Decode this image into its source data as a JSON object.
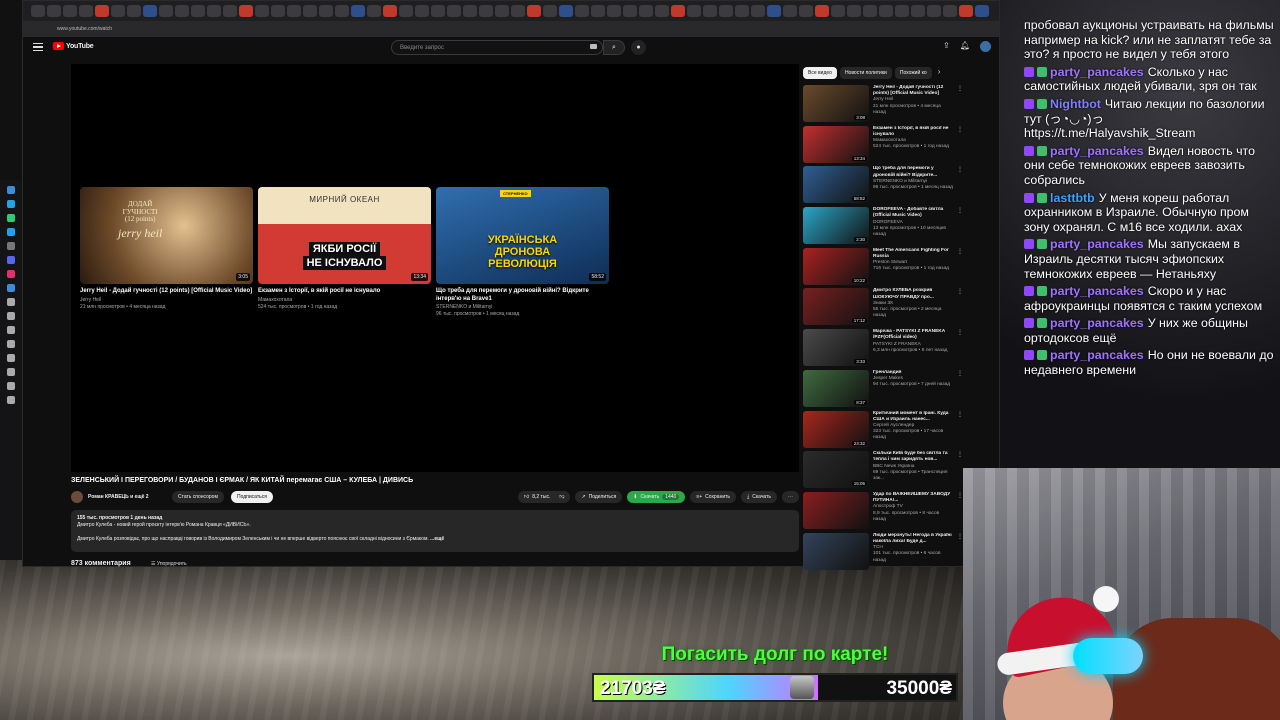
{
  "browser": {
    "url": "www.youtube.com/watch"
  },
  "youtube": {
    "search_placeholder": "Введите запрос",
    "video": {
      "title": "ЗЕЛЕНСЬКИЙ І ПЕРЕГОВОРИ / БУДАНОВ І ЄРМАК / ЯК КИТАЙ перемагає США – КУЛЕБА | ДИВИСЬ",
      "channel": "Роман КРАВЕЦЬ и ещё 2",
      "sponsor_label": "Стать спонсором",
      "subscribe_label": "Подписаться",
      "likes": "8,2 тыс.",
      "share_label": "Поделиться",
      "download_label": "Скачать",
      "quality_label": "1440",
      "save_label": "Сохранить",
      "download2_label": "Скачать",
      "stats": "155 тыс. просмотров  1 день назад",
      "desc_line1": "Дмитро Кулеба - новий герой проєкту інтерв'ю Романа Кравця «ДИВИСЬ».",
      "desc_line2": "Дмитро Кулеба розповідає, про що насправді говорив із Володимиром Зеленським і чи не вперше відверто пояснює свої складні відносини з Єрмаком.",
      "desc_more": "...ещё",
      "comments": "873 комментария",
      "sort_label": "Упорядочить"
    },
    "endcards": [
      {
        "title": "Jerry Heil - Додай гучності (12 points) [Official Music Video]",
        "channel": "Jerry Heil",
        "meta": "21 млн просмотров • 4 месяца назад",
        "duration": "3:05",
        "overlay_line1": "ДОДАЙ",
        "overlay_line2": "ГУЧНОСТІ",
        "overlay_line3": "(12 points)",
        "overlay_brand": "jerry heil"
      },
      {
        "title": "Екзамен з Історії, в якій росії не існувало",
        "channel": "Мамахохотала",
        "meta": "524 тыс. просмотров • 1 год назад",
        "duration": "13:34",
        "overlay_top": "МИРНИЙ ОКЕАН",
        "overlay_line1": "ЯКБИ РОСІЇ",
        "overlay_line2": "НЕ ІСНУВАЛО"
      },
      {
        "title": "Що треба для перемоги у дроновій війні? Відкрите інтерв'ю на Brave1",
        "channel": "STERNENKO и Militarnyi",
        "meta": "96 тыс. просмотров • 1 месяц назад",
        "duration": "58:52",
        "overlay_tag": "СТЕРНЕНКО",
        "overlay_line1": "УКРАЇНСЬКА",
        "overlay_line2": "ДРОНОВА",
        "overlay_line3": "РЕВОЛЮЦІЯ"
      }
    ],
    "chips": [
      "Все видео",
      "Новости политики",
      "Похожий ко"
    ],
    "recommendations": [
      {
        "title": "Jerry Heil - Додай гучності (12 points) [Official Music Video]",
        "channel": "Jerry Heil",
        "meta": "21 млн просмотров • 4 месяца назад",
        "duration": "3:08",
        "color": "#6b4a2c"
      },
      {
        "title": "Екзамен з Історії, в якій росії не існувало",
        "channel": "Мамахохотала",
        "meta": "524 тыс. просмотров • 1 год назад",
        "duration": "13:34",
        "color": "#c13030"
      },
      {
        "title": "Що треба для перемоги у дроновій війні? Відкрите...",
        "channel": "STERNENKO и Militarnyi",
        "meta": "96 тыс. просмотров • 1 месяц назад",
        "duration": "58:52",
        "color": "#2f5f93"
      },
      {
        "title": "DOROFEEVA - Добавте світла (Official Music Video)",
        "channel": "DOROFEEVA",
        "meta": "13 млн просмотров • 10 месяцев назад",
        "duration": "2:30",
        "color": "#2aa6c9"
      },
      {
        "title": "Meet The Americans Fighting For Russia",
        "channel": "Preston Stewart",
        "meta": "716 тыс. просмотров • 1 год назад",
        "duration": "10:22",
        "color": "#aa2222"
      },
      {
        "title": "Дмитро КУЛЕБА розкрив ШОКУЮЧУ ПРАВДУ про...",
        "channel": "Знаки ЗК",
        "meta": "55 тыс. просмотров • 2 месяца назад",
        "duration": "17:12",
        "color": "#7a2020"
      },
      {
        "title": "Марічка - PATSYKI Z FRANEKA /PZF(Official video)",
        "channel": "PATSYKI Z FRANEKA",
        "meta": "6,3 млн просмотров • 6 лет назад",
        "duration": "3:33",
        "color": "#4b4b4b"
      },
      {
        "title": "Гренландия",
        "channel": "Jesper Makes",
        "meta": "94 тыс. просмотров • 7 дней назад",
        "duration": "8:37",
        "color": "#3f6b3f"
      },
      {
        "title": "Критичний момент в Ірані. Куда США и Израиль нанес...",
        "channel": "Сергей Ауслендер",
        "meta": "323 тыс. просмотров • 17 часов назад",
        "duration": "23:32",
        "color": "#a8261d"
      },
      {
        "title": "Скільки Київ буде без світла та тепла і чим заридять нов...",
        "channel": "BBC News Україна",
        "meta": "69 тыс. просмотров • Трансляция зак...",
        "duration": "15:05",
        "color": "#2b2b2b"
      },
      {
        "title": "Удар по ВАЖНЕЙШЕМУ ЗАВОДУ ПУТИНА!...",
        "channel": "Апостроф TV",
        "meta": "8,9 тыс. просмотров • 8 часов назад",
        "duration": "",
        "color": "#8a1f1f"
      },
      {
        "title": "Люди мерзнуть! Негода в Україні накоїла лиха! Буде д...",
        "channel": "ТСН",
        "meta": "101 тыс. просмотров • 6 часов назад",
        "duration": "",
        "color": "#33445a"
      }
    ]
  },
  "chat": [
    {
      "user": "",
      "text": "пробовал аукционы устраивать на фильмы например на kick? или не заплатят тебе за это? я просто не видел у тебя этого"
    },
    {
      "user": "party_pancakes",
      "text": "Сколько у нас самостийных людей убивали, зря он так"
    },
    {
      "user": "Nightbot",
      "text": "Читаю лекции по базологии тут (っ◔◡◔)っ https://t.me/Halyavshik_Stream"
    },
    {
      "user": "party_pancakes",
      "text": "Видел новость что они себе темнокожих евреев завозить собрались"
    },
    {
      "user": "lasttbtb",
      "text": "У меня кореш работал охранником в Израиле. Обычную пром зону охранял. С м16 все ходили. ахах"
    },
    {
      "user": "party_pancakes",
      "text": "Мы запускаем в Израиль десятки тысяч эфиопских темнокожих евреев — Нетаньяху"
    },
    {
      "user": "party_pancakes",
      "text": "Скоро и у нас афроукраинцы появятся с таким успехом"
    },
    {
      "user": "party_pancakes",
      "text": "У них же общины ортодоксов ещё"
    },
    {
      "user": "party_pancakes",
      "text": "Но они не воевали до недавнего времени"
    }
  ],
  "donation": {
    "title": "Погасить долг по карте!",
    "current": "21703₴",
    "goal": "35000₴",
    "progress": 0.62
  }
}
